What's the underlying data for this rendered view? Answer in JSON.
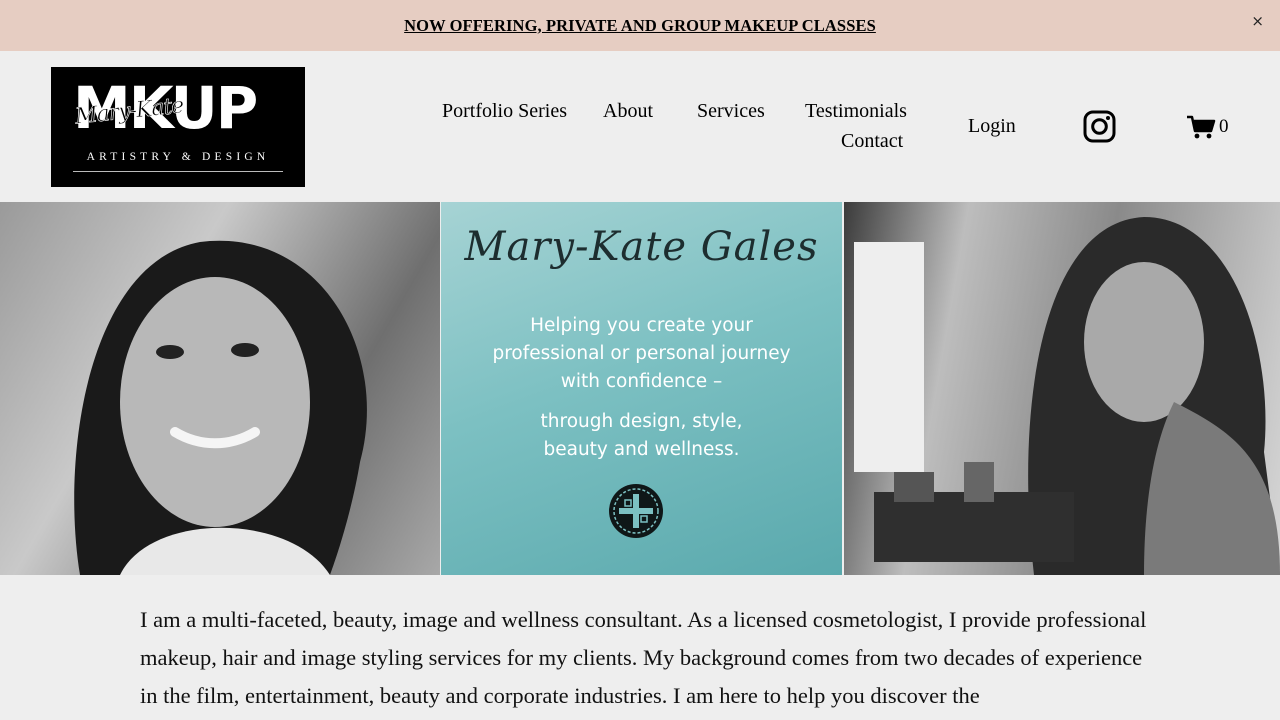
{
  "announcement": {
    "text": "NOW OFFERING, PRIVATE AND GROUP MAKEUP CLASSES",
    "close_glyph": "×"
  },
  "logo": {
    "main": "MKUP",
    "script": "Mary-Kate",
    "sub": "ARTISTRY & DESIGN"
  },
  "nav": {
    "portfolio": "Portfolio Series",
    "about": "About",
    "services": "Services",
    "testimonials": "Testimonials",
    "contact": "Contact",
    "login": "Login"
  },
  "icons": {
    "social": "instagram-icon",
    "cart": "cart-icon"
  },
  "cart": {
    "count": "0"
  },
  "hero": {
    "signature": "Mary-Kate Gales",
    "tagline_1": [
      "Helping you create your",
      "professional or personal journey",
      "with confidence –"
    ],
    "tagline_2": [
      "through design, style,",
      "beauty and wellness."
    ]
  },
  "intro": {
    "text": "I am a multi-faceted, beauty, image and wellness consultant. As a licensed cosmetologist, I provide professional makeup, hair and image styling services for my clients. My background comes from two decades of experience in the film, entertainment, beauty and corporate industries. I am here to help you discover the"
  },
  "colors": {
    "announcement_bg": "#e6cdc2",
    "page_bg": "#eeeeee",
    "teal_panel": "#7cc0c2"
  }
}
